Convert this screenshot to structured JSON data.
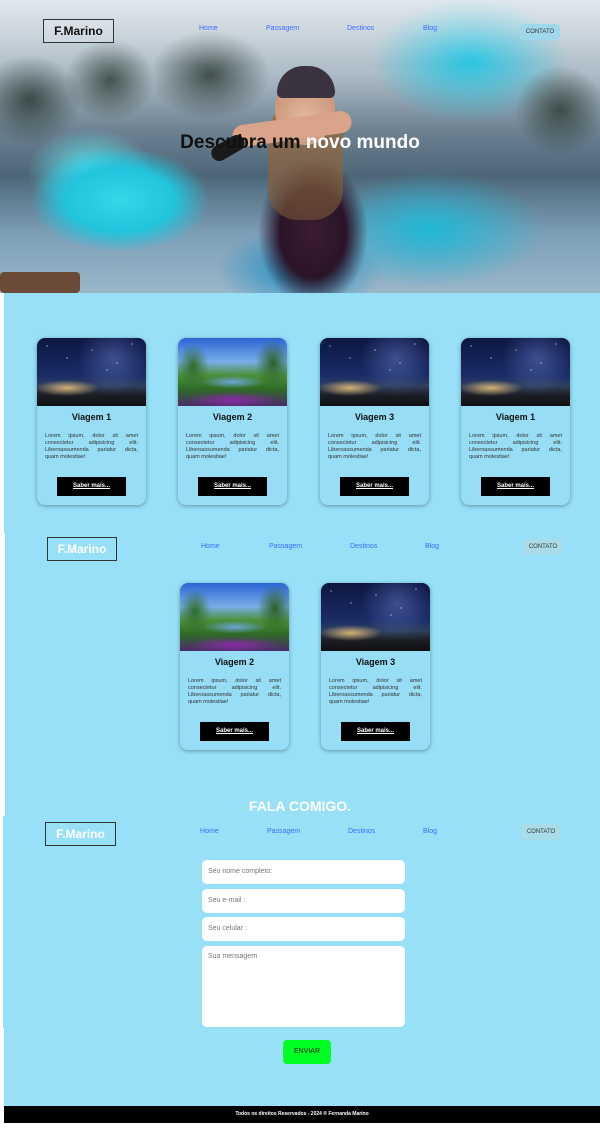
{
  "nav": {
    "logo": "F.Marino",
    "links": [
      "Home",
      "Passagem",
      "Destinos",
      "Blog"
    ],
    "contact": "CONTATO"
  },
  "hero": {
    "title_dark": "Descubra um ",
    "title_light": "novo mundo"
  },
  "cards_row1": [
    {
      "title": "Viagem 1",
      "text": "Lorem ipsum, dolor sit amet consectetur adipisicing elit. Liberoassumenda pariatur dicta, quam molestiae!",
      "button": "Saber mais..."
    },
    {
      "title": "Viagem 2",
      "text": "Lorem ipsum, dolor sit amet consectetur adipisicing elit. Liberoassumenda pariatur dicta, quam molestiae!",
      "button": "Saber mais..."
    },
    {
      "title": "Viagem 3",
      "text": "Lorem ipsum, dolor sit amet consectetur adipisicing elit. Liberoassumenda pariatur dicta, quam molestiae!",
      "button": "Saber mais..."
    },
    {
      "title": "Viagem 1",
      "text": "Lorem ipsum, dolor sit amet consectetur adipisicing elit. Liberoassumenda pariatur dicta, quam molestiae!",
      "button": "Saber mais..."
    }
  ],
  "cards_row2": [
    {
      "title": "Viagem 2",
      "text": "Lorem ipsum, dolor sit amet consectetur adipisicing elit. Liberoassumenda pariatur dicta, quam molestiae!",
      "button": "Saber mais..."
    },
    {
      "title": "Viagem 3",
      "text": "Lorem ipsum, dolor sit amet consectetur adipisicing elit. Liberoassumenda pariatur dicta, quam molestiae!",
      "button": "Saber mais..."
    }
  ],
  "contact_section": {
    "heading": "FALA COMIGO.",
    "name_placeholder": "Seu nome completo:",
    "email_placeholder": "Seu e-mail :",
    "phone_placeholder": "Seu celular :",
    "message_placeholder": "Sua mensagem",
    "send": "ENVIAR"
  },
  "footer": {
    "text": "Todos os direitos Reservados - 2024 ® Fernanda Marino"
  },
  "colors": {
    "section_bg": "#97e0f7",
    "link": "#3a6bff",
    "send_button": "#00ff22"
  }
}
